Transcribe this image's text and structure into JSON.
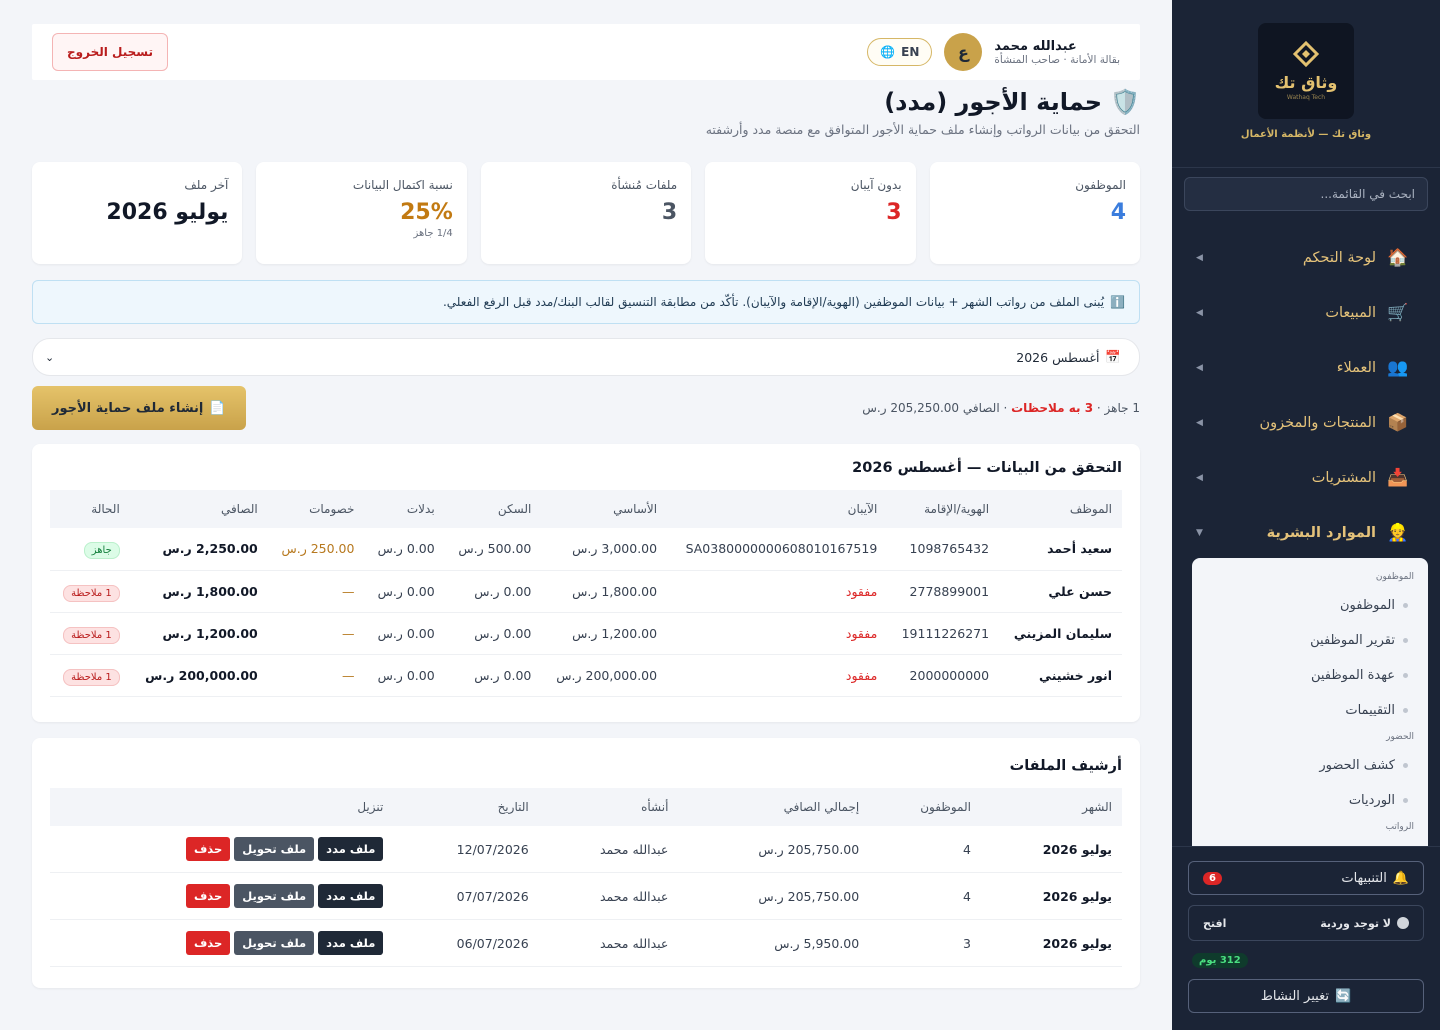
{
  "sidebar": {
    "logo_text": "وثاق تك",
    "logo_sub": "Wathaq Tech",
    "tagline": "وثاق تك — لأنظمة الأعمال",
    "search_placeholder": "ابحث في القائمة...",
    "nav": [
      {
        "label": "لوحة التحكم",
        "icon": "🏠"
      },
      {
        "label": "المبيعات",
        "icon": "🛒"
      },
      {
        "label": "العملاء",
        "icon": "👥"
      },
      {
        "label": "المنتجات والمخزون",
        "icon": "📦"
      },
      {
        "label": "المشتريات",
        "icon": "📥"
      },
      {
        "label": "الموارد البشرية",
        "icon": "👷"
      }
    ],
    "sub_groups": [
      "الموظفون",
      "الحضور",
      "الرواتب"
    ],
    "sub_items": [
      "الموظفون",
      "تقرير الموظفين",
      "عهدة الموظفين",
      "التقييمات",
      "كشف الحضور",
      "الورديات"
    ],
    "alerts_label": "التنبيهات",
    "alerts_count": "6",
    "shift_label": "لا توجد وردية",
    "shift_action": "افتح",
    "days_badge": "312 يوم",
    "change_label": "تغيير النشاط"
  },
  "topbar": {
    "user_name": "عبدالله محمد",
    "user_role": "بقالة الأمانة · صاحب المنشأة",
    "avatar_letter": "ع",
    "lang": "EN",
    "logout": "تسجيل الخروج"
  },
  "page": {
    "title": "حماية الأجور (مدد)",
    "subtitle": "التحقق من بيانات الرواتب وإنشاء ملف حماية الأجور المتوافق مع منصة مدد وأرشفته"
  },
  "stats": [
    {
      "label": "الموظفون",
      "value": "4",
      "color": "#3b7ddd",
      "note": ""
    },
    {
      "label": "بدون آيبان",
      "value": "3",
      "color": "#dc2626",
      "note": ""
    },
    {
      "label": "ملفات مُنشأة",
      "value": "3",
      "color": "#4b5563",
      "note": ""
    },
    {
      "label": "نسبة اكتمال البيانات",
      "value": "25%",
      "color": "#c27a12",
      "note": "1/4 جاهز"
    },
    {
      "label": "آخر ملف",
      "value": "يوليو 2026",
      "color": "#111827",
      "note": ""
    }
  ],
  "info": "يُبنى الملف من رواتب الشهر + بيانات الموظفين (الهوية/الإقامة والآيبان). تأكّد من مطابقة التنسيق لقالب البنك/مدد قبل الرفع الفعلي.",
  "month": "أغسطس 2026",
  "summary": {
    "ready": "1 جاهز · ",
    "warn": "3 به ملاحظات",
    "net": " · الصافي 205,250.00 ر.س"
  },
  "generate_label": "إنشاء ملف حماية الأجور",
  "validation": {
    "title": "التحقق من البيانات — أغسطس 2026",
    "headers": [
      "الموظف",
      "الهوية/الإقامة",
      "الآيبان",
      "الأساسي",
      "السكن",
      "بدلات",
      "خصومات",
      "الصافي",
      "الحالة"
    ],
    "rows": [
      {
        "name": "سعيد أحمد",
        "id": "1098765432",
        "iban": "SA0380000000608010167519",
        "basic": "3,000.00 ر.س",
        "housing": "500.00 ر.س",
        "allow": "0.00 ر.س",
        "deduct": "250.00 ر.س",
        "net": "2,250.00 ر.س",
        "status": "جاهز",
        "ok": true
      },
      {
        "name": "حسن علي",
        "id": "2778899001",
        "iban": "مفقود",
        "basic": "1,800.00 ر.س",
        "housing": "0.00 ر.س",
        "allow": "0.00 ر.س",
        "deduct": "—",
        "net": "1,800.00 ر.س",
        "status": "1 ملاحظة",
        "ok": false
      },
      {
        "name": "سليمان المزيني",
        "id": "19111226271",
        "iban": "مفقود",
        "basic": "1,200.00 ر.س",
        "housing": "0.00 ر.س",
        "allow": "0.00 ر.س",
        "deduct": "—",
        "net": "1,200.00 ر.س",
        "status": "1 ملاحظة",
        "ok": false
      },
      {
        "name": "انور خشيني",
        "id": "2000000000",
        "iban": "مفقود",
        "basic": "200,000.00 ر.س",
        "housing": "0.00 ر.س",
        "allow": "0.00 ر.س",
        "deduct": "—",
        "net": "200,000.00 ر.س",
        "status": "1 ملاحظة",
        "ok": false
      }
    ]
  },
  "archive": {
    "title": "أرشيف الملفات",
    "headers": [
      "الشهر",
      "الموظفون",
      "إجمالي الصافي",
      "أنشأه",
      "التاريخ",
      "تنزيل"
    ],
    "buttons": {
      "mudad": "ملف مدد",
      "transfer": "ملف تحويل",
      "delete": "حذف"
    },
    "rows": [
      {
        "month": "يوليو 2026",
        "employees": "4",
        "total": "205,750.00 ر.س",
        "by": "عبدالله محمد",
        "date": "12/07/2026"
      },
      {
        "month": "يوليو 2026",
        "employees": "4",
        "total": "205,750.00 ر.س",
        "by": "عبدالله محمد",
        "date": "07/07/2026"
      },
      {
        "month": "يوليو 2026",
        "employees": "3",
        "total": "5,950.00 ر.س",
        "by": "عبدالله محمد",
        "date": "06/07/2026"
      }
    ]
  }
}
